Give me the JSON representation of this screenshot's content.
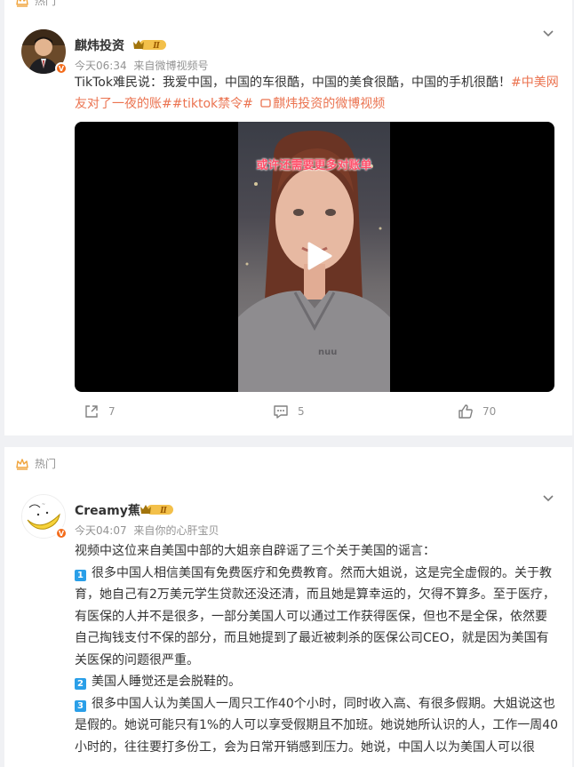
{
  "post1": {
    "hot_label": "热门",
    "username": "麒炜投资",
    "level": "Ⅱ",
    "time": "今天06:34",
    "source_prefix": "来自",
    "source": "微博视频号",
    "text_plain": "TikTok难民说：我爱中国，中国的车很酷，中国的美食很酷，中国的手机很酷！",
    "tag1": "#中美网友对了一夜的账#",
    "tag2": "#tiktok禁令#",
    "video_link": "麒炜投资的微博视频",
    "video_caption": "或许还需要更多对账单",
    "actions": {
      "share": "7",
      "comment": "5",
      "like": "70"
    }
  },
  "post2": {
    "hot_label": "热门",
    "username": "Creamy蕉",
    "level": "Ⅱ",
    "time": "今天04:07",
    "source_prefix": "来自",
    "source": "你的心肝宝贝",
    "intro": "视频中这位来自美国中部的大姐亲自辟谣了三个关于美国的谣言：",
    "points": [
      {
        "n": "1",
        "text": "很多中国人相信美国有免费医疗和免费教育。然而大姐说，这是完全虚假的。关于教育，她自己有2万美元学生贷款还没还清，而且她是算幸运的，欠得不算多。至于医疗，有医保的人并不是很多，一部分美国人可以通过工作获得医保，但也不是全保，依然要自己掏钱支付不保的部分，而且她提到了最近被刺杀的医保公司CEO，就是因为美国有关医保的问题很严重。"
      },
      {
        "n": "2",
        "text": "美国人睡觉还是会脱鞋的。"
      },
      {
        "n": "3",
        "text": "很多中国人认为美国人一周只工作40个小时，同时收入高、有很多假期。大姐说这也是假的。她说可能只有1%的人可以享受假期且不加班。她说她所认识的人，工作一周40小时的，往往要打多份工，会为日常开销感到压力。她说，中国人以为美国人可以很"
      }
    ]
  },
  "colors": {
    "link": "#eb7350",
    "badge_blue": "#2a9fe8",
    "verified_orange": "#f36b1b"
  }
}
